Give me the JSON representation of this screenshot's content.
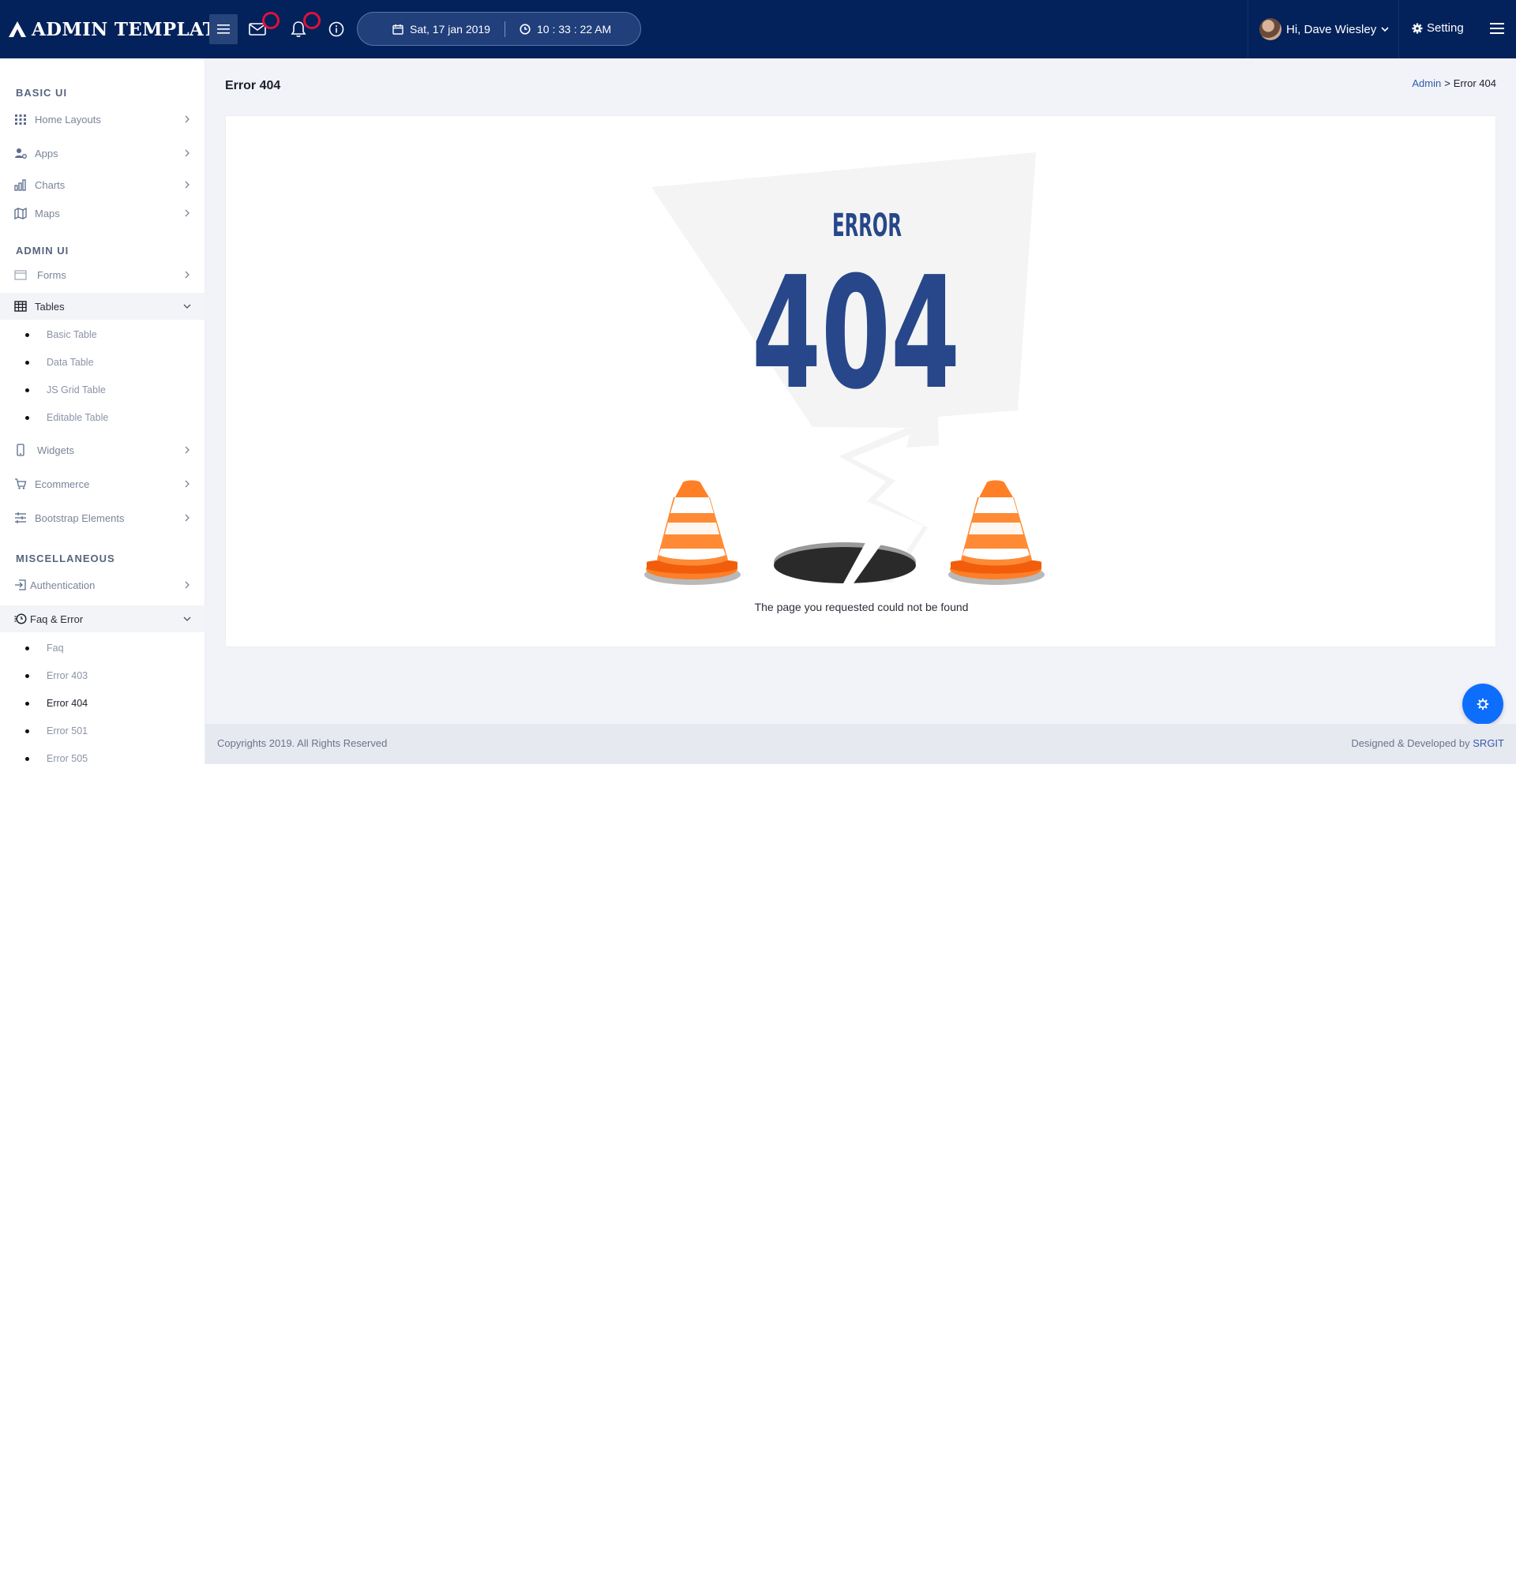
{
  "app": {
    "logo_text": "ADMIN TEMPLATE"
  },
  "topbar": {
    "date": "Sat, 17 jan 2019",
    "time": "10 : 33 : 22 AM",
    "user_greeting": "Hi, Dave Wiesley",
    "setting_label": "Setting",
    "icons": [
      "hamburger-menu-icon",
      "mail-icon",
      "bell-icon",
      "info-icon",
      "calendar-icon",
      "clock-icon",
      "chevron-down-icon",
      "gear-icon",
      "menu-lines-icon"
    ]
  },
  "sidebar": {
    "sections": [
      {
        "title": "BASIC UI",
        "items": [
          {
            "label": "Home Layouts",
            "icon": "grid-icon"
          },
          {
            "label": "Apps",
            "icon": "user-apps-icon"
          },
          {
            "label": "Charts",
            "icon": "bar-chart-icon"
          },
          {
            "label": "Maps",
            "icon": "map-icon"
          }
        ]
      },
      {
        "title": "ADMIN UI",
        "items": [
          {
            "label": "Forms",
            "icon": "form-icon"
          },
          {
            "label": "Tables",
            "icon": "table-icon",
            "expanded": true,
            "children": [
              "Basic Table",
              "Data Table",
              "JS Grid Table",
              "Editable Table"
            ]
          },
          {
            "label": "Widgets",
            "icon": "mobile-icon"
          },
          {
            "label": "Ecommerce",
            "icon": "cart-icon"
          },
          {
            "label": "Bootstrap Elements",
            "icon": "sliders-icon"
          }
        ]
      },
      {
        "title": "MISCELLANEOUS",
        "items": [
          {
            "label": "Authentication",
            "icon": "login-icon"
          },
          {
            "label": "Faq & Error",
            "icon": "history-icon",
            "expanded": true,
            "children": [
              "Faq",
              "Error 403",
              "Error 404",
              "Error 501",
              "Error 505"
            ],
            "current": "Error 404"
          }
        ]
      }
    ]
  },
  "main": {
    "page_title": "Error 404",
    "breadcrumb": {
      "parent": "Admin",
      "separator": ">",
      "current": "Error 404"
    },
    "error": {
      "word": "ERROR",
      "code": "404",
      "message": "The page you requested could not be found"
    }
  },
  "footer": {
    "copyright": "Copyrights 2019. All Rights Reserved",
    "credit_prefix": "Designed & Developed by",
    "credit_link": "SRGIT"
  },
  "colors": {
    "topbar_bg": "#03225b",
    "accent_blue": "#27478a",
    "cone_orange": "#ff7f27",
    "fab_blue": "#0d6efd",
    "badge_red": "#e0103a"
  }
}
